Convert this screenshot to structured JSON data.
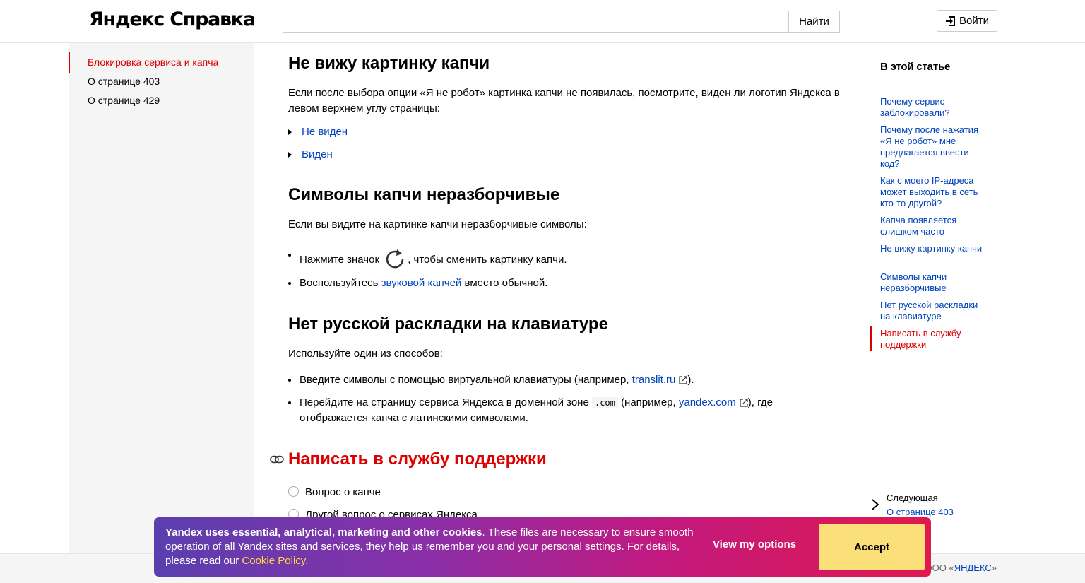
{
  "header": {
    "logo": "Яндекс Справка",
    "search_value": "",
    "search_button": "Найти",
    "login_button": "Войти"
  },
  "sidebar": {
    "items": [
      {
        "label": "Блокировка сервиса и капча",
        "active": true
      },
      {
        "label": "О странице 403",
        "active": false
      },
      {
        "label": "О странице 429",
        "active": false
      }
    ]
  },
  "main": {
    "s1": {
      "title": "Не вижу картинку капчи",
      "text_line1": "Если после выбора опции «Я не робот» картинка капчи не появилась, посмотрите, виден ли логотип Яндекса в",
      "text_line2": "левом верхнем углу страницы:",
      "cut1": "Не виден",
      "cut2": "Виден"
    },
    "s2": {
      "title": "Символы капчи неразборчивые",
      "intro": "Если вы видите на картинке капчи неразборчивые символы:",
      "li1_before": "Нажмите значок",
      "li1_after": ", чтобы сменить картинку капчи.",
      "li2_before": "Воспользуйтесь",
      "li2_link": "звуковой капчей",
      "li2_after": "вместо обычной."
    },
    "s3": {
      "title": "Нет русской раскладки на клавиатуре",
      "intro": "Используйте один из способов:",
      "li1_before": "Введите символы с помощью виртуальной клавиатуры (например,",
      "li1_link": "translit.ru",
      "li1_after": ").",
      "li2_before": "Перейдите на страницу сервиса Яндекса в доменной зоне",
      "li2_code": ".com",
      "li2_mid": "(например,",
      "li2_link": "yandex.com",
      "li2_after": "), где",
      "li2_line2": "отображается капча с латинскими символами."
    },
    "s4": {
      "title": "Написать в службу поддержки",
      "radio1": "Вопрос о капче",
      "radio2": "Другой вопрос о сервисах Яндекса"
    }
  },
  "toc": {
    "title": "В этой статье",
    "items": [
      {
        "label": "Почему сервис заблокировали?",
        "active": false
      },
      {
        "label": "Почему после нажатия «Я не робот» мне предлагается ввести код?",
        "active": false
      },
      {
        "label": "Как с моего IP-адреса может выходить в сеть кто-то другой?",
        "active": false
      },
      {
        "label": "Капча появляется слишком часто",
        "active": false
      },
      {
        "label": "Не вижу картинку капчи",
        "active": false
      },
      {
        "label": "Символы капчи неразборчивые",
        "active": false
      },
      {
        "label": "Нет русской раскладки на клавиатуре",
        "active": false
      },
      {
        "label": "Написать в службу поддержки",
        "active": true
      }
    ],
    "next_caption": "Следующая",
    "next_link": "О странице 403"
  },
  "footer": {
    "copyright_prefix": "ООО «",
    "copyright_link": "ЯНДЕКС",
    "copyright_suffix": "»"
  },
  "cookie": {
    "bold": "Yandex uses essential, analytical, marketing and other cookies",
    "text": ". These files are necessary to ensure smooth operation of all Yandex sites and services, they help us remember you and your personal settings. For details, please read our ",
    "link": "Cookie Policy",
    "end": ".",
    "options_button": "View my options",
    "accept_button": "Accept"
  },
  "colors": {
    "accent_red": "#dd0000",
    "link_blue": "#0044bb",
    "accept_yellow": "#fbe07a"
  },
  "icons": [
    "login-icon",
    "refresh-icon",
    "external-link-icon",
    "anchor-link-icon",
    "chevron-right-icon",
    "triangle-right-icon"
  ]
}
